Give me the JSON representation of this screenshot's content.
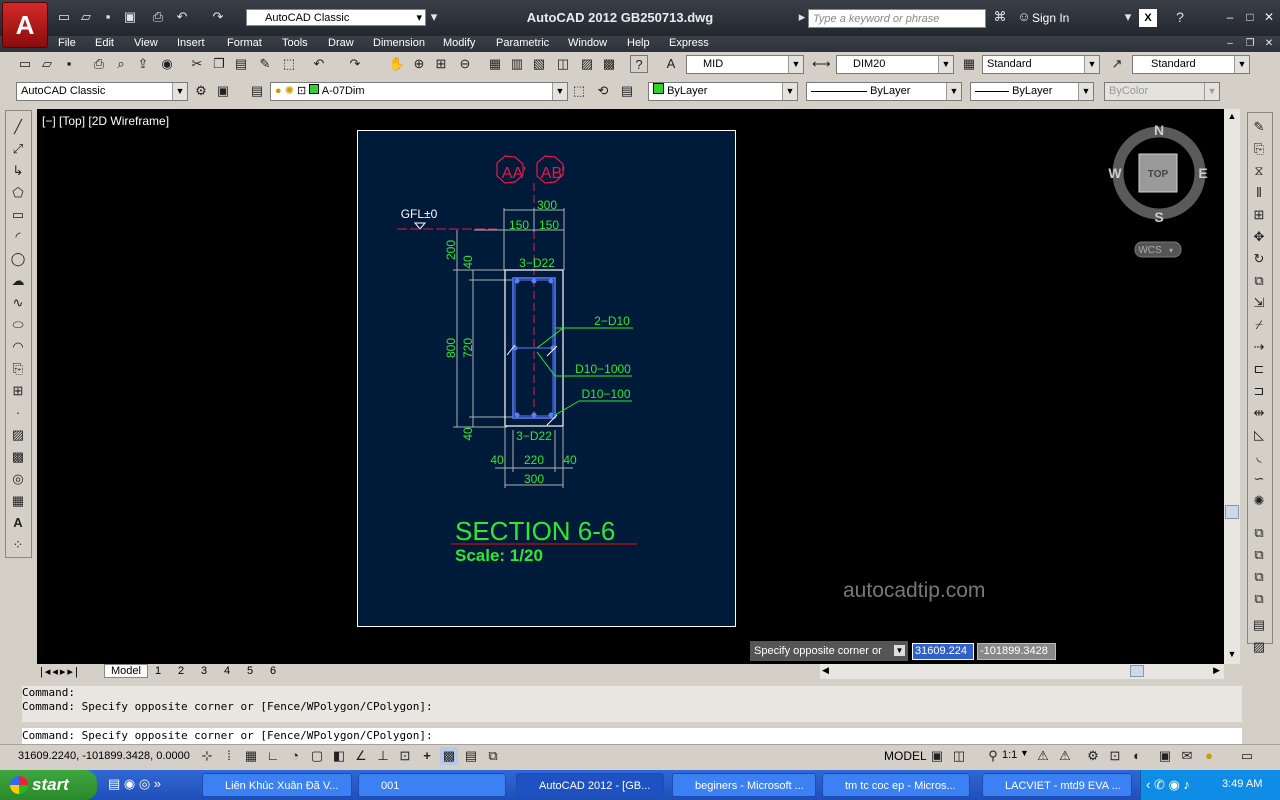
{
  "app": {
    "title": "AutoCAD 2012    GB250713.dwg",
    "workspace": "AutoCAD Classic",
    "search_placeholder": "Type a keyword or phrase",
    "sign_in": "Sign In"
  },
  "menu": [
    "File",
    "Edit",
    "View",
    "Insert",
    "Format",
    "Tools",
    "Draw",
    "Dimension",
    "Modify",
    "Parametric",
    "Window",
    "Help",
    "Express"
  ],
  "styles": {
    "text_style": "MID",
    "dim_style": "DIM20",
    "table_style": "Standard",
    "mleader_style": "Standard"
  },
  "layers": {
    "workspace": "AutoCAD Classic",
    "current_layer": "A-07Dim",
    "color": "ByLayer",
    "linetype": "ByLayer",
    "lineweight": "ByLayer",
    "plotstyle": "ByColor"
  },
  "viewport": {
    "label": "[−] [Top] [2D Wireframe]",
    "viewcube": {
      "n": "N",
      "s": "S",
      "e": "E",
      "w": "W",
      "top": "TOP",
      "wcs": "WCS"
    }
  },
  "drawing": {
    "grid_a": "AA'",
    "grid_b": "AB'",
    "gfl": "GFL±0",
    "dim_top_total": "300",
    "dim_top_left": "150",
    "dim_top_right": "150",
    "dim_200": "200",
    "dim_40_top": "40",
    "dim_800": "800",
    "dim_720": "720",
    "dim_40_bottom": "40",
    "rebar_top": "3−D22",
    "rebar_side": "2−D10",
    "stirrup_1": "D10−1000",
    "stirrup_2": "D10−100",
    "rebar_bottom": "3−D22",
    "dim_bot_40_left": "40",
    "dim_bot_220": "220",
    "dim_bot_40_right": "40",
    "dim_bot_total": "300",
    "section_title": "SECTION 6-6",
    "scale": "Scale: 1/20"
  },
  "watermark": "autocadtip.com",
  "tooltip": {
    "prompt": "Specify opposite corner or",
    "x": "31609.224",
    "y": "-101899.3428"
  },
  "layout_tabs": [
    "Model",
    "1",
    "2",
    "3",
    "4",
    "5",
    "6"
  ],
  "command": {
    "history": [
      "Command:",
      "Command: Specify opposite corner or [Fence/WPolygon/CPolygon]:"
    ],
    "current": "Command: Specify opposite corner or [Fence/WPolygon/CPolygon]:"
  },
  "statusbar": {
    "coords": "31609.2240, -101899.3428, 0.0000",
    "model": "MODEL",
    "scale": "1:1"
  },
  "taskbar": {
    "start": "start",
    "tasks": [
      "Liên Khúc Xuân Đã V...",
      "001",
      "AutoCAD 2012 - [GB...",
      "beginers - Microsoft ...",
      "tm tc coc ep - Micros...",
      "LACVIET - mtd9 EVA ..."
    ],
    "clock": "3:49 AM"
  },
  "colors": {
    "paper_bg": "#001a3a",
    "dim_green": "#2fe82f",
    "grid_red": "#e8184a",
    "accent_red": "#c01010"
  }
}
